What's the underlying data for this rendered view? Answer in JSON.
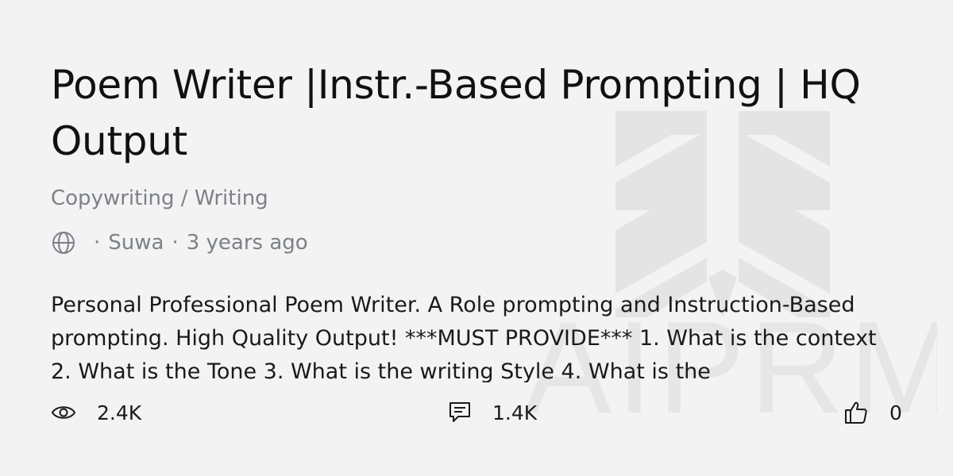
{
  "prompt": {
    "title": "Poem Writer |Instr.-Based Prompting | HQ Output",
    "category": "Copywriting / Writing",
    "meta": {
      "visibility_icon": "globe-icon",
      "separator": "·",
      "author": "Suwa",
      "time_ago": "3 years ago"
    },
    "description": "Personal Professional Poem Writer. A Role prompting and Instruction-Based prompting. High Quality Output! ***MUST PROVIDE*** 1. What is the context 2. What is the Tone 3. What is the writing Style 4. What is the"
  },
  "stats": {
    "views": {
      "icon": "eye-icon",
      "value": "2.4K"
    },
    "comments": {
      "icon": "comment-icon",
      "value": "1.4K"
    },
    "likes": {
      "icon": "thumbs-up-icon",
      "value": "0"
    }
  },
  "watermark": {
    "icon": "aiprm-logo-watermark",
    "text": "AIPRM"
  },
  "colors": {
    "background": "#f3f3f3",
    "title": "#111111",
    "muted": "#7c8089",
    "watermark": "#e4e4e4"
  }
}
